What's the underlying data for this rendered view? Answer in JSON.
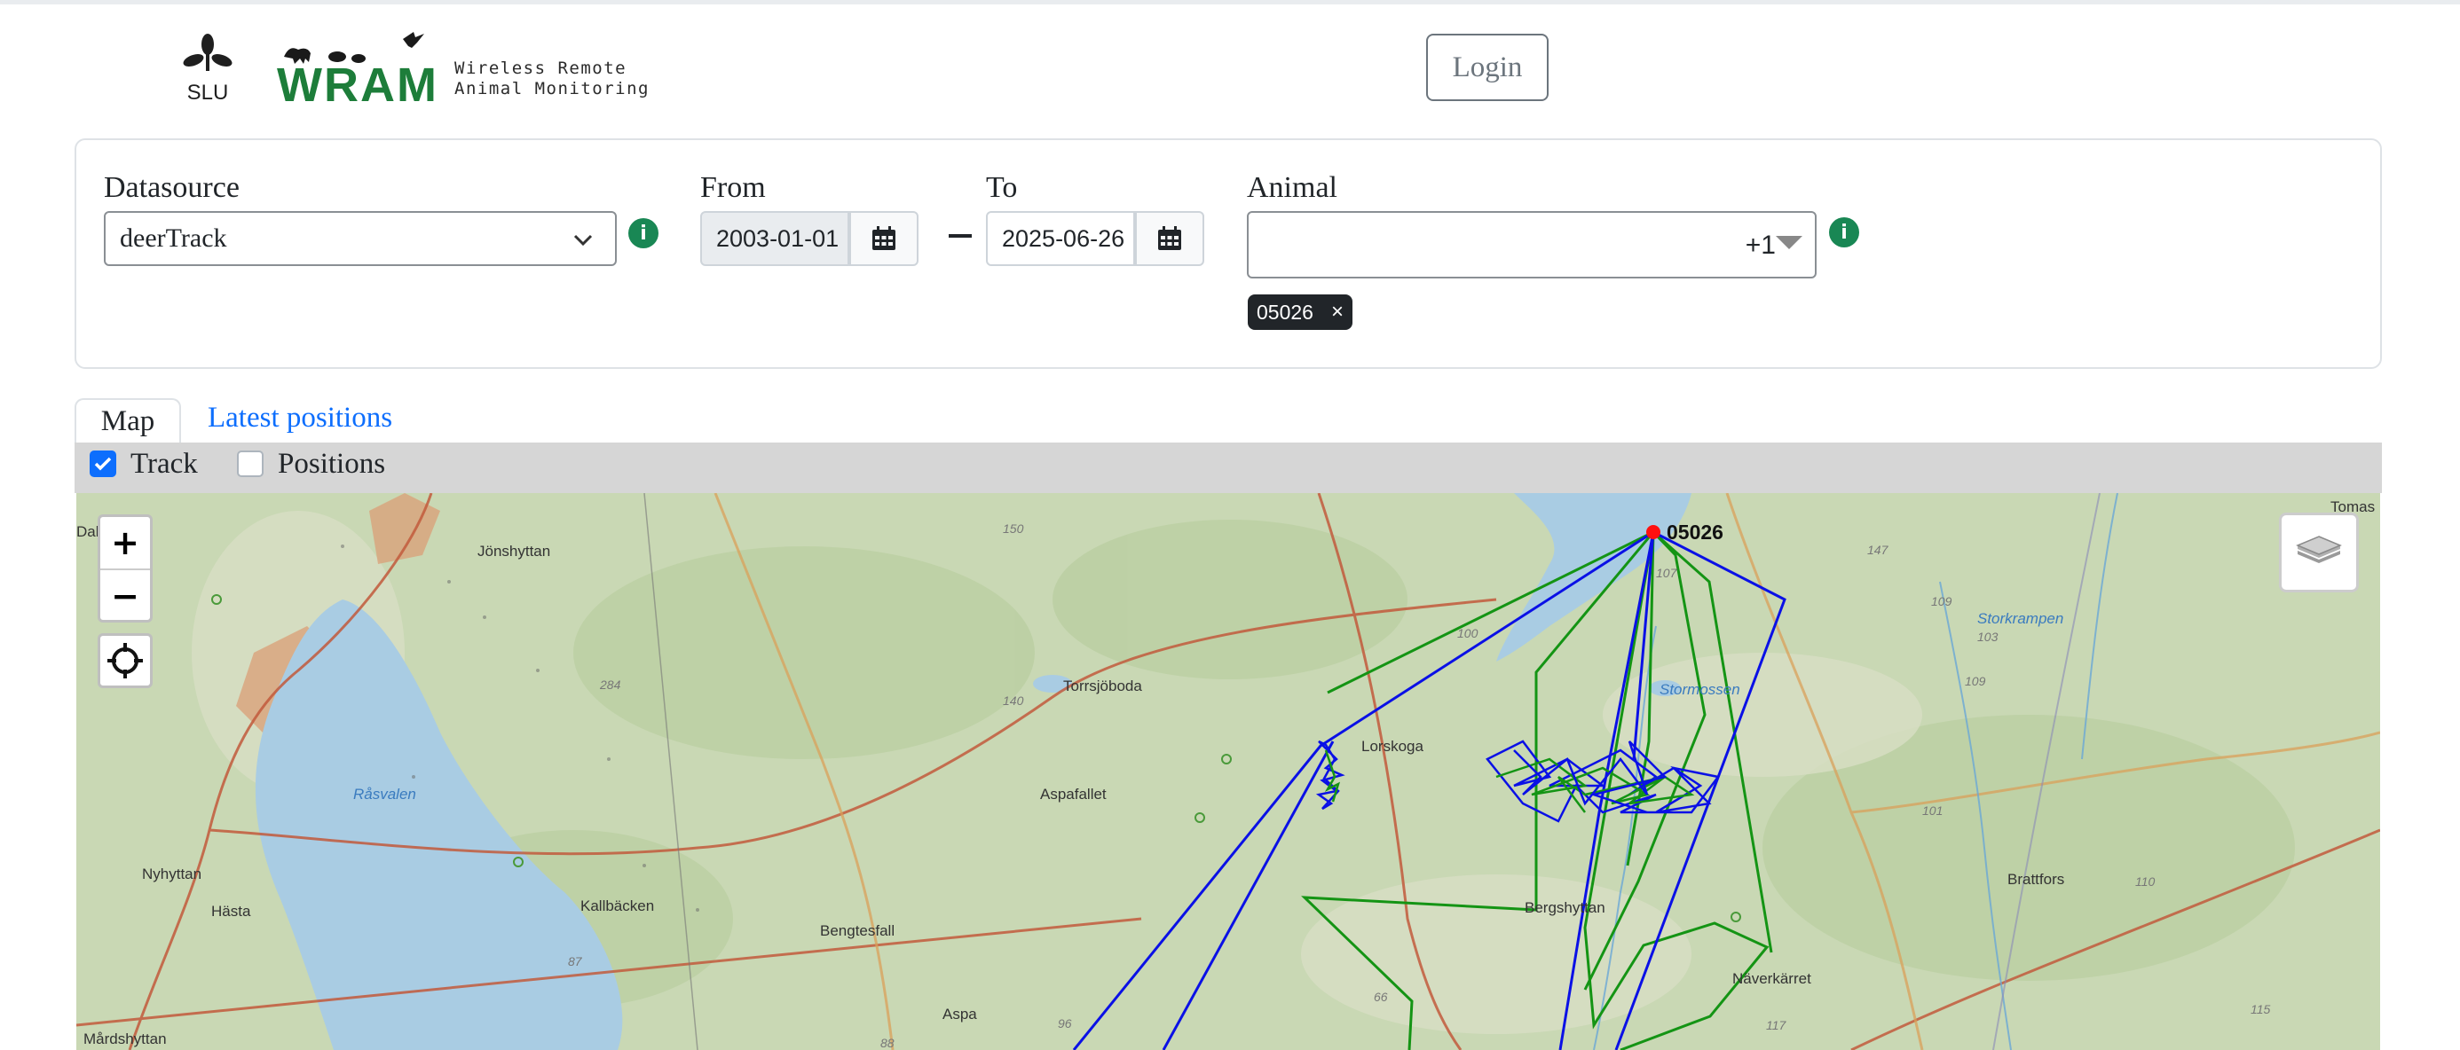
{
  "header": {
    "logo_slu_text": "SLU",
    "logo_wram_text": "WRAM",
    "logo_subtitle_line1": "Wireless Remote",
    "logo_subtitle_line2": "Animal Monitoring",
    "login_label": "Login"
  },
  "filters": {
    "datasource_label": "Datasource",
    "datasource_value": "deerTrack",
    "from_label": "From",
    "from_value": "2003-01-01",
    "to_label": "To",
    "to_value": "2025-06-26",
    "animal_label": "Animal",
    "animal_more_count": "+1",
    "selected_animals": [
      "05026"
    ],
    "chip_remove": "×",
    "info_icon": "i"
  },
  "tabs": [
    {
      "label": "Map",
      "active": true
    },
    {
      "label": "Latest positions",
      "active": false
    }
  ],
  "layers_toggle": {
    "track_label": "Track",
    "track_checked": true,
    "positions_label": "Positions",
    "positions_checked": false
  },
  "map": {
    "zoom_in": "+",
    "zoom_out": "−",
    "animal_marker_label": "05026",
    "colors": {
      "track_blue": "#0a10e6",
      "track_green": "#149414",
      "marker": "#ff1010",
      "water": "#a9cce3",
      "land": "#c9d8b4"
    },
    "places": [
      "Jönshyttan",
      "Torrsjöboda",
      "Aspafallet",
      "Bengtesfall",
      "Nyhyttan",
      "Hästa",
      "Kallbäcken",
      "Aspa",
      "Bergshyttan",
      "Näverkärret",
      "Brattfors",
      "Mårdshyttan",
      "Tomas",
      "Råsvalen",
      "Stormossen",
      "Storkrampen",
      "Lorskoga",
      "Dal"
    ],
    "elevations": [
      "150",
      "100",
      "107",
      "147",
      "109",
      "103",
      "109",
      "284",
      "101",
      "110",
      "115",
      "117",
      "88",
      "96",
      "87",
      "66",
      "140"
    ]
  }
}
